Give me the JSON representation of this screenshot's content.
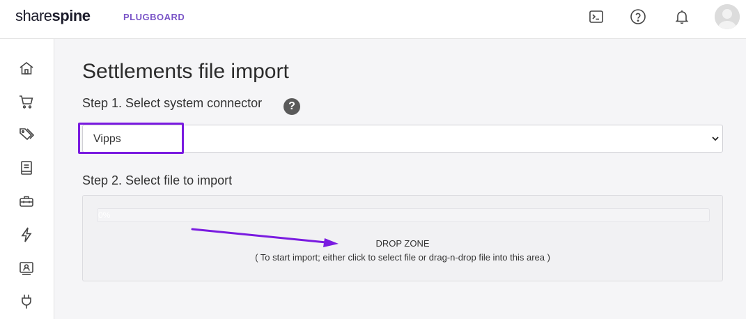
{
  "header": {
    "logo_light": "share",
    "logo_bold": "spine",
    "product": "PLUGBOARD"
  },
  "page": {
    "title": "Settlements file import",
    "step1_label": "Step 1. Select system connector",
    "help_symbol": "?",
    "connector_selected": "Vipps",
    "step2_label": "Step 2. Select file to import"
  },
  "dropzone": {
    "progress_label": "0%",
    "progress_fraction": 0,
    "title": "DROP ZONE",
    "subtitle": "( To start import; either click to select file or drag-n-drop file into this area )"
  },
  "sidebar": {
    "items": [
      "home-icon",
      "cart-icon",
      "tags-icon",
      "book-icon",
      "toolbox-icon",
      "lightning-icon",
      "contacts-icon",
      "plug-icon"
    ]
  },
  "topbar_icons": [
    "terminal-icon",
    "help-icon",
    "bell-icon"
  ],
  "colors": {
    "brand_purple": "#7a55c7",
    "highlight": "#7a1be0",
    "annotation_arrow": "#7a1be0"
  }
}
